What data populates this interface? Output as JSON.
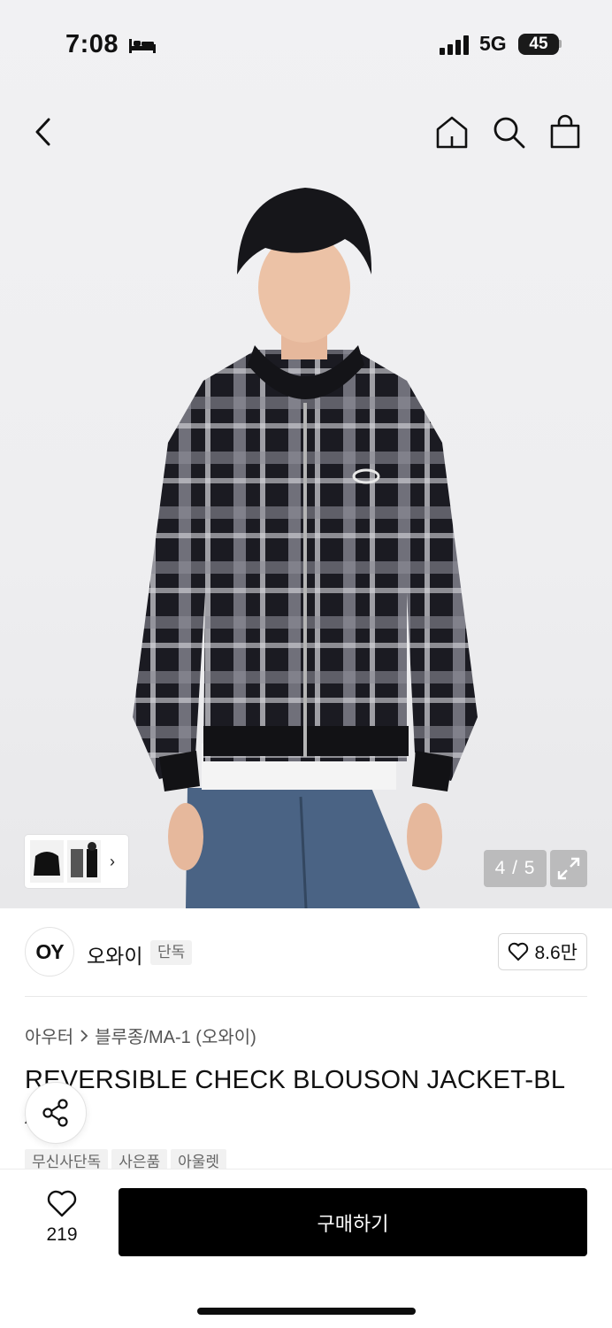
{
  "status_bar": {
    "time": "7:08",
    "network": "5G",
    "battery": "45"
  },
  "gallery": {
    "pager": "4 / 5",
    "thumb_more": "›"
  },
  "brand": {
    "logo": "OY",
    "name": "오와이",
    "badge": "단독",
    "likes": "8.6만"
  },
  "breadcrumb": {
    "category": "아우터",
    "subcategory": "블루종/MA-1 (오와이)"
  },
  "product": {
    "title_line1": "REVERSIBLE CHECK BLOUSON JACKET-BL",
    "title_line2": "A"
  },
  "tags": [
    "무신사단독",
    "사은품",
    "아울렛"
  ],
  "bottom": {
    "fav_count": "219",
    "buy_label": "구매하기"
  },
  "icons": [
    "bed-icon",
    "signal-icon",
    "back-icon",
    "home-icon",
    "search-icon",
    "bag-icon",
    "expand-icon",
    "heart-icon",
    "share-icon"
  ]
}
